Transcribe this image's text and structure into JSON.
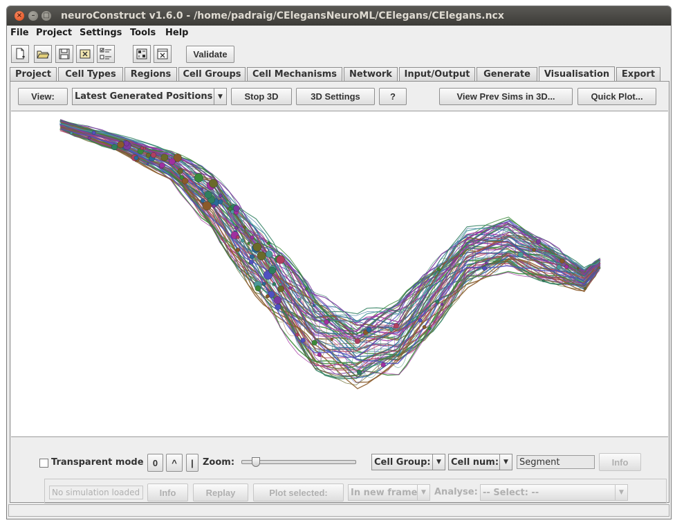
{
  "window": {
    "title": "neuroConstruct v1.6.0 - /home/padraig/CElegansNeuroML/CElegans/CElegans.ncx",
    "close_glyph": "×",
    "min_glyph": "–",
    "max_glyph": "□"
  },
  "menu": [
    "File",
    "Project",
    "Settings",
    "Tools",
    "Help"
  ],
  "toolbar": {
    "icons": [
      "new-project-icon",
      "open-project-icon",
      "save-project-icon",
      "close-project-icon",
      "preferences-icon",
      "generate-icon",
      "exit-icon"
    ],
    "validate_label": "Validate"
  },
  "tabs": [
    "Project",
    "Cell Types",
    "Regions",
    "Cell Groups",
    "Cell Mechanisms",
    "Network",
    "Input/Output",
    "Generate",
    "Visualisation",
    "Export"
  ],
  "active_tab": "Visualisation",
  "view_bar": {
    "view_label": "View:",
    "view_selected": "Latest Generated Positions",
    "stop3d_label": "Stop 3D",
    "settings3d_label": "3D Settings",
    "help_label": "?",
    "prev_sims_label": "View Prev Sims in 3D...",
    "quick_plot_label": "Quick Plot..."
  },
  "controls": {
    "transparent_label": "Transparent mode",
    "transparent_checked": false,
    "zero_label": "0",
    "up_label": "^",
    "bar_label": "|",
    "zoom_label": "Zoom:",
    "zoom_level": 0.1,
    "cell_group_label": "Cell Group:",
    "cell_num_label": "Cell num:",
    "segment_value": "Segment",
    "info_label": "Info"
  },
  "sim_controls": {
    "no_sim_placeholder": "No simulation loaded",
    "info_label": "Info",
    "replay_label": "Replay",
    "plot_selected_label": "Plot selected:",
    "new_frame_value": "In new frame",
    "analyse_label": "Analyse:",
    "select_value": "-- Select: --"
  },
  "colors": {
    "accent_title": "#3c3b37",
    "neuron_colors": [
      "#3a8a3a",
      "#7a3aa0",
      "#2a6a9a",
      "#b04060",
      "#4a9a9a",
      "#6a6a2a",
      "#8a5a2a",
      "#5050c0",
      "#2f7f5f",
      "#a030a0"
    ]
  }
}
